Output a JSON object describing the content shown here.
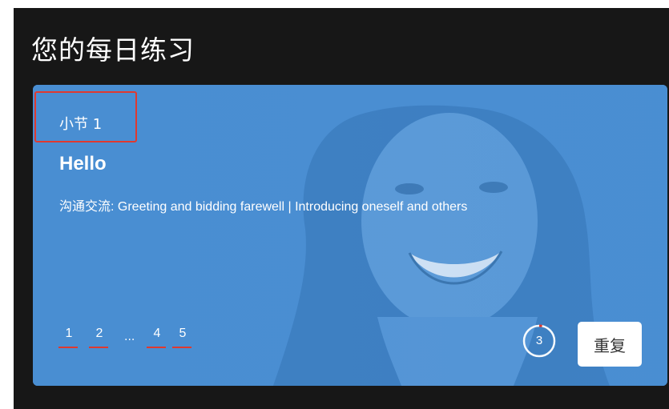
{
  "page": {
    "title": "您的每日练习"
  },
  "lesson_card": {
    "lesson_number": "小节 1",
    "title": "Hello",
    "description": "沟通交流: Greeting and bidding farewell | Introducing oneself and others",
    "pager": {
      "items": [
        "1",
        "2",
        "4",
        "5"
      ],
      "ellipsis": "..."
    },
    "progress": {
      "count": "3",
      "fraction": 0.03
    },
    "repeat_label": "重复"
  },
  "colors": {
    "background": "#171717",
    "card": "#4c8fd3",
    "accent_red": "#e0392f",
    "text": "#ffffff"
  }
}
